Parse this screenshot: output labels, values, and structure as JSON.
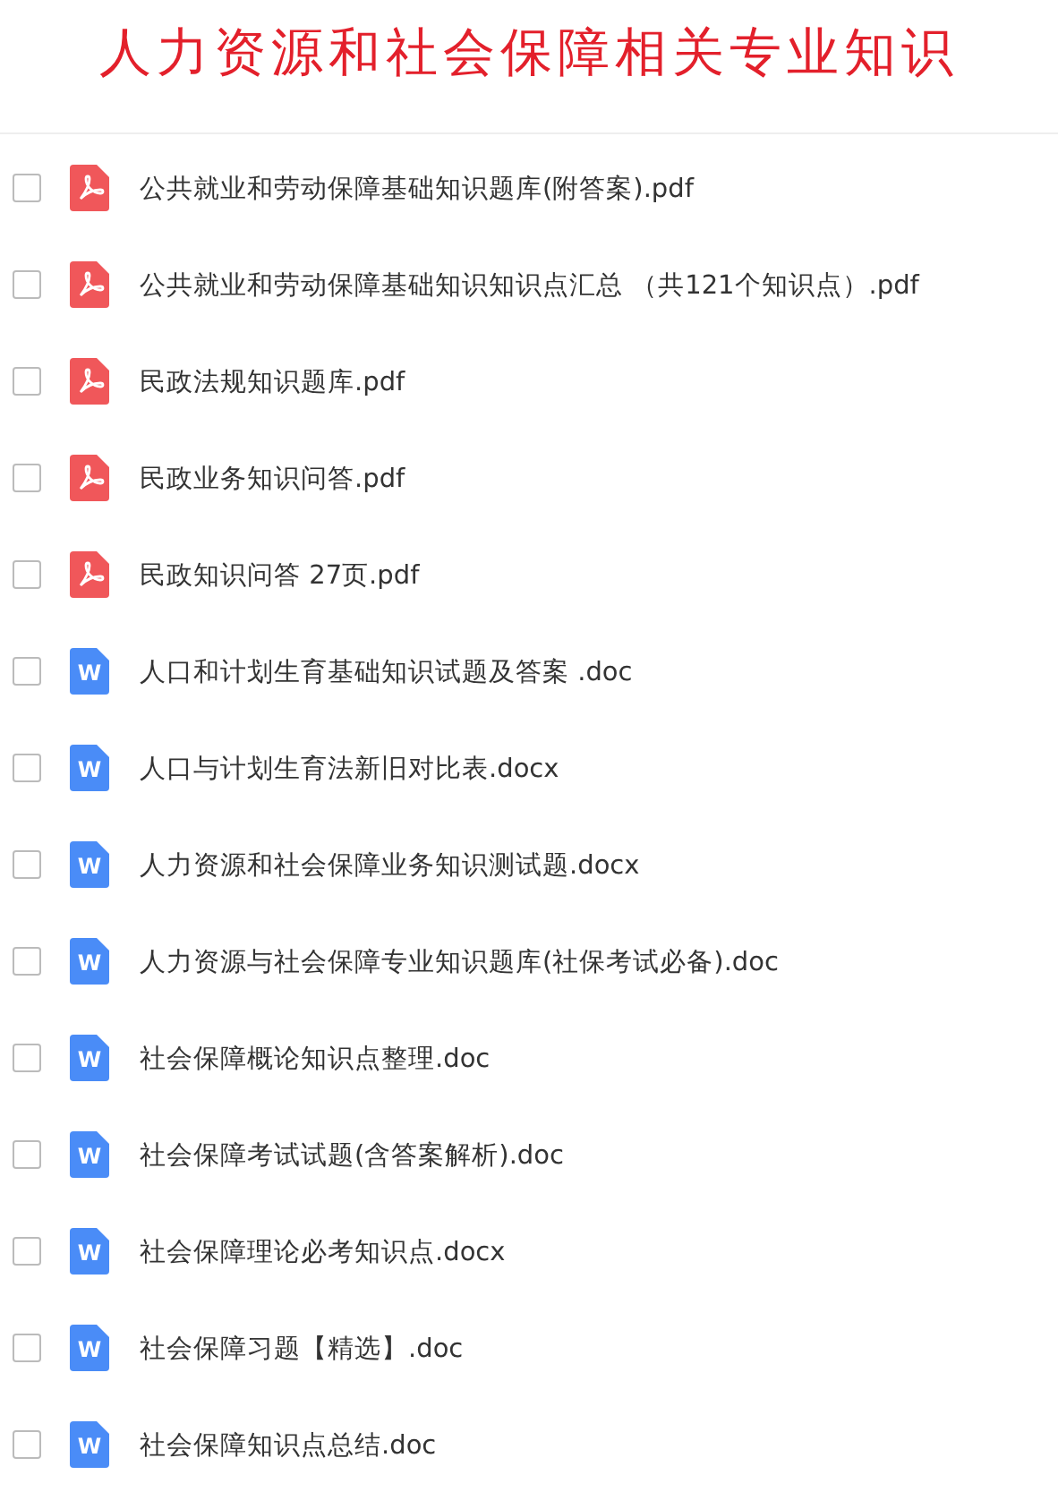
{
  "title": "人力资源和社会保障相关专业知识",
  "files": [
    {
      "kind": "pdf",
      "name": "公共就业和劳动保障基础知识题库(附答案).pdf",
      "checked": false
    },
    {
      "kind": "pdf",
      "name": "公共就业和劳动保障基础知识知识点汇总 （共121个知识点）.pdf",
      "checked": false
    },
    {
      "kind": "pdf",
      "name": "民政法规知识题库.pdf",
      "checked": false
    },
    {
      "kind": "pdf",
      "name": "民政业务知识问答.pdf",
      "checked": false
    },
    {
      "kind": "pdf",
      "name": "民政知识问答 27页.pdf",
      "checked": false
    },
    {
      "kind": "doc",
      "icon_letter": "W",
      "name": "人口和计划生育基础知识试题及答案 .doc",
      "checked": false
    },
    {
      "kind": "doc",
      "icon_letter": "W",
      "name": "人口与计划生育法新旧对比表.docx",
      "checked": false
    },
    {
      "kind": "doc",
      "icon_letter": "W",
      "name": "人力资源和社会保障业务知识测试题.docx",
      "checked": false
    },
    {
      "kind": "doc",
      "icon_letter": "W",
      "name": "人力资源与社会保障专业知识题库(社保考试必备).doc",
      "checked": false
    },
    {
      "kind": "doc",
      "icon_letter": "W",
      "name": "社会保障概论知识点整理.doc",
      "checked": false
    },
    {
      "kind": "doc",
      "icon_letter": "W",
      "name": "社会保障考试试题(含答案解析).doc",
      "checked": false
    },
    {
      "kind": "doc",
      "icon_letter": "W",
      "name": "社会保障理论必考知识点.docx",
      "checked": false
    },
    {
      "kind": "doc",
      "icon_letter": "W",
      "name": "社会保障习题【精选】.doc",
      "checked": false
    },
    {
      "kind": "doc",
      "icon_letter": "W",
      "name": "社会保障知识点总结.doc",
      "checked": false
    }
  ]
}
